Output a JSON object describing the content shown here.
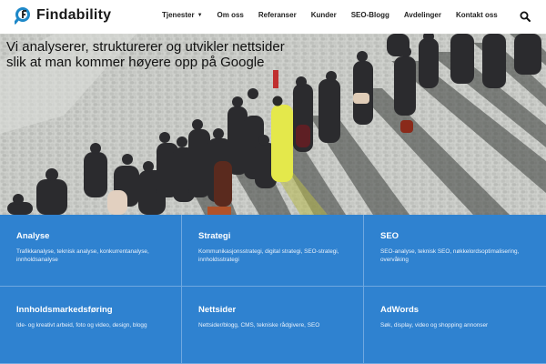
{
  "header": {
    "logo_text": "Findability",
    "nav": [
      {
        "label": "Tjenester",
        "has_dropdown": true
      },
      {
        "label": "Om oss"
      },
      {
        "label": "Referanser"
      },
      {
        "label": "Kunder"
      },
      {
        "label": "SEO-Blogg"
      },
      {
        "label": "Avdelinger"
      },
      {
        "label": "Kontakt oss"
      }
    ],
    "search_icon": "search-icon"
  },
  "hero": {
    "headline": "Vi analyserer, strukturerer og utvikler nettsider slik at man kommer høyere opp på Google"
  },
  "services": [
    {
      "title": "Analyse",
      "desc": "Trafikkanalyse, teknisk analyse, konkurrentanalyse, innholdsanalyse"
    },
    {
      "title": "Strategi",
      "desc": "Kommunikasjonsstrategi, digital strategi, SEO-strategi, innholdsstrategi"
    },
    {
      "title": "SEO",
      "desc": "SEO-analyse, teknisk SEO, nøkkelordsoptimalisering, overvåking"
    },
    {
      "title": "Innholdsmarkedsføring",
      "desc": "Ide- og kreativt arbeid, foto og video, design, blogg"
    },
    {
      "title": "Nettsider",
      "desc": "Nettsider/blogg, CMS, tekniske rådgivere, SEO"
    },
    {
      "title": "AdWords",
      "desc": "Søk, display, video og shopping annonser"
    }
  ],
  "colors": {
    "brand_blue": "#1e88c8",
    "tile_blue": "#2f82d0",
    "coat_yellow": "#e5e800"
  }
}
